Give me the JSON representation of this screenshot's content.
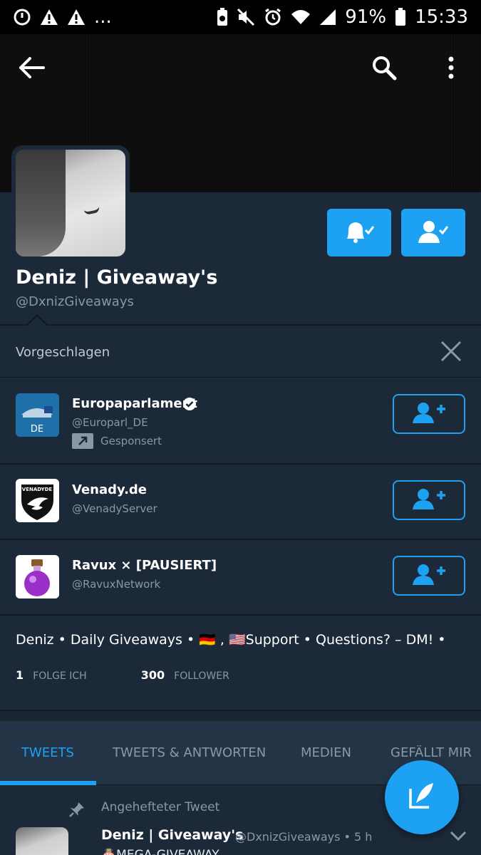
{
  "status_bar": {
    "battery_percent": "91%",
    "time": "15:33",
    "overflow": "...",
    "left_icons": [
      "sync-icon",
      "warning-icon",
      "warning-icon"
    ],
    "right_icons": [
      "battery-saver-icon",
      "mute-icon",
      "alarm-icon",
      "wifi-icon",
      "signal-icon",
      "battery-icon"
    ]
  },
  "toolbar": {
    "back_icon": "back-arrow-icon",
    "search_icon": "search-icon",
    "more_icon": "more-vertical-icon"
  },
  "profile": {
    "display_name": "Deniz | Giveaway's",
    "handle": "@DxnizGiveaways",
    "notifications_button_icon": "bell-check-icon",
    "following_button_icon": "user-check-icon",
    "bio": "Deniz • Daily Giveaways • 🇩🇪 , 🇺🇸Support • Questions? – DM! •",
    "following_count": "1",
    "following_label": "FOLGE ICH",
    "followers_count": "300",
    "followers_label": "FOLLOWER"
  },
  "suggestions": {
    "title": "Vorgeschlagen",
    "items": [
      {
        "name": "Europaparlament",
        "handle": "@Europarl_DE",
        "verified": true,
        "promoted_label": "Gesponsert",
        "avatar_text": "DE"
      },
      {
        "name": "Venady.de",
        "handle": "@VenadyServer",
        "avatar_text": "VENADYDE"
      },
      {
        "name": "Ravux × [PAUSIERT]",
        "handle": "@RavuxNetwork"
      }
    ]
  },
  "tabs": [
    {
      "label": "TWEETS",
      "active": true
    },
    {
      "label": "TWEETS & ANTWORTEN",
      "active": false
    },
    {
      "label": "MEDIEN",
      "active": false
    },
    {
      "label": "GEFÄLLT MIR",
      "active": false
    }
  ],
  "pinned_tweet": {
    "pinned_label": "Angehefteter Tweet",
    "author_name": "Deniz | Giveaway's",
    "author_meta": "@DxnizGiveaways • 5 h",
    "text": "🎂MEGA-GIVEAWAY"
  },
  "colors": {
    "accent": "#1da1f2",
    "background": "#1c2938",
    "tab_bar": "#243447",
    "secondary_text": "#8899a6"
  }
}
